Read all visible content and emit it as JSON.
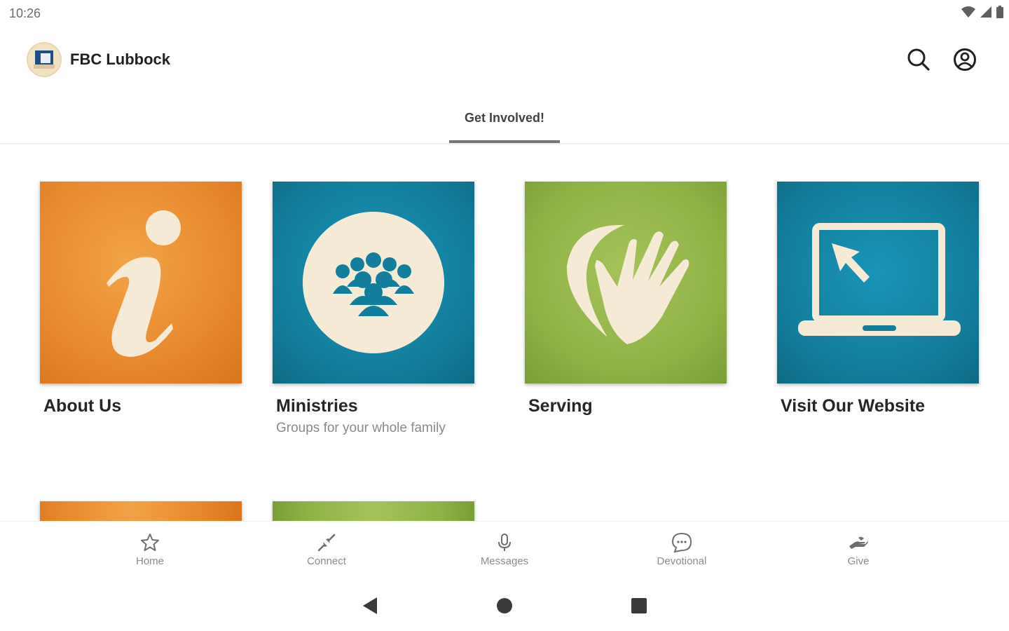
{
  "status": {
    "time": "10:26"
  },
  "appbar": {
    "title": "FBC Lubbock"
  },
  "tabs": [
    {
      "label": "Get Involved!"
    }
  ],
  "cards": [
    {
      "title": "About Us",
      "subtitle": ""
    },
    {
      "title": "Ministries",
      "subtitle": "Groups for your whole family"
    },
    {
      "title": "Serving",
      "subtitle": ""
    },
    {
      "title": "Visit Our Website",
      "subtitle": ""
    }
  ],
  "bottom_nav": [
    {
      "label": "Home",
      "icon": "star-icon"
    },
    {
      "label": "Connect",
      "icon": "connect-icon"
    },
    {
      "label": "Messages",
      "icon": "microphone-icon"
    },
    {
      "label": "Devotional",
      "icon": "chat-bubble-icon"
    },
    {
      "label": "Give",
      "icon": "give-icon"
    }
  ],
  "colors": {
    "orange_tile": "#e8892e",
    "teal_tile": "#137e9c",
    "green_tile": "#8fb245",
    "cream": "#f5ead6"
  }
}
